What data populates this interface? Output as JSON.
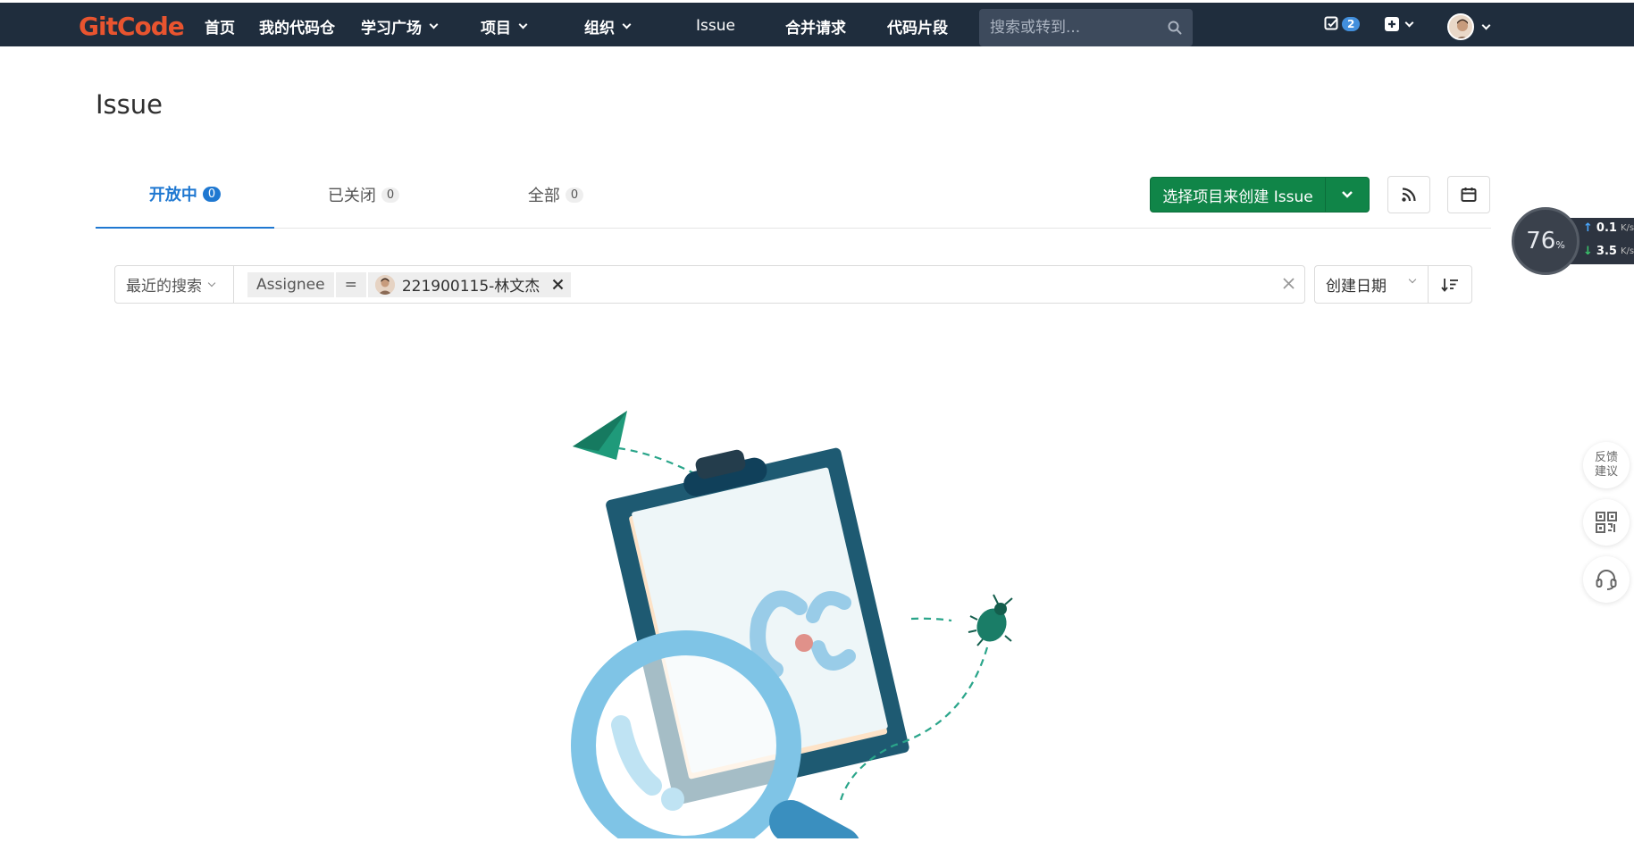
{
  "nav": {
    "logo": "GitCode",
    "items": [
      {
        "label": "首页",
        "dropdown": false
      },
      {
        "label": "我的代码仓",
        "dropdown": false
      },
      {
        "label": "学习广场",
        "dropdown": true
      },
      {
        "label": "项目",
        "dropdown": true
      },
      {
        "label": "组织",
        "dropdown": true
      },
      {
        "label": "Issue",
        "dropdown": false
      },
      {
        "label": "合并请求",
        "dropdown": false
      },
      {
        "label": "代码片段",
        "dropdown": false
      }
    ],
    "search_placeholder": "搜索或转到...",
    "todo_count": "2"
  },
  "page": {
    "title": "Issue"
  },
  "tabs": [
    {
      "label": "开放中",
      "count": "0",
      "active": true
    },
    {
      "label": "已关闭",
      "count": "0",
      "active": false
    },
    {
      "label": "全部",
      "count": "0",
      "active": false
    }
  ],
  "actions": {
    "create_label": "选择项目来创建 Issue"
  },
  "filter": {
    "recent_label": "最近的搜索",
    "token_key": "Assignee",
    "token_op": "=",
    "token_value": "221900115-林文杰",
    "sort_label": "创建日期"
  },
  "speed_widget": {
    "percent": "76",
    "percent_unit": "%",
    "upload": "0.1",
    "download": "3.5",
    "unit": "K/s"
  },
  "side_tools": {
    "feedback": "反馈\n建议"
  },
  "colors": {
    "nav_bg": "#1f2d3d",
    "brand": "#e8542f",
    "primary": "#1f78d1",
    "success": "#108548"
  }
}
